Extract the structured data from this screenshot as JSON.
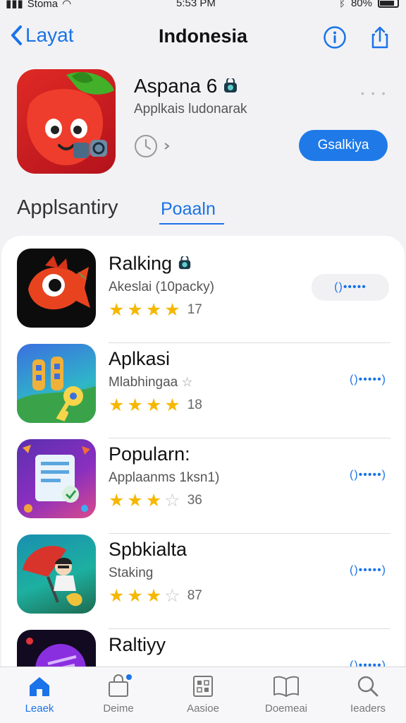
{
  "status_bar": {
    "carrier": "Stoma",
    "time": "5:53 PM",
    "battery": "80%"
  },
  "nav": {
    "back_label": "Layat",
    "title": "Indonesia"
  },
  "hero": {
    "title": "Aspana 6",
    "subtitle": "Applkais ludonarak",
    "dots": "• • •",
    "get_label": "Gsalkiya"
  },
  "tabs": {
    "inactive_label": "Applsantiry",
    "active_label": "Poaaln"
  },
  "apps": [
    {
      "name": "Ralking",
      "category": "Akeslai (10packy)",
      "stars": 4,
      "rating_count": "17",
      "action": "()•••••"
    },
    {
      "name": "Aplkasi",
      "category": "Mlabhingaa",
      "stars": 4,
      "rating_count": "18",
      "action": "()•••••)"
    },
    {
      "name": "Popularn:",
      "category": "Applaanms 1ksn1)",
      "stars": 3,
      "rating_count": "36",
      "action": "()•••••)"
    },
    {
      "name": "Spbkialta",
      "category": "Staking",
      "stars": 3,
      "rating_count": "87",
      "action": "()•••••)"
    },
    {
      "name": "Raltiyy",
      "category": "",
      "stars": 0,
      "rating_count": "",
      "action": "()•••••)"
    }
  ],
  "tab_bar": [
    {
      "label": "Leaek",
      "icon": "home-icon",
      "active": true
    },
    {
      "label": "Deime",
      "icon": "bag-icon",
      "active": false
    },
    {
      "label": "Aasioe",
      "icon": "grid-icon",
      "active": false
    },
    {
      "label": "Doemeai",
      "icon": "book-icon",
      "active": false
    },
    {
      "label": "Ieaders",
      "icon": "search-icon",
      "active": false
    }
  ],
  "colors": {
    "accent": "#1a73e8",
    "star": "#f5b800",
    "get_button": "#1f7ae8"
  }
}
